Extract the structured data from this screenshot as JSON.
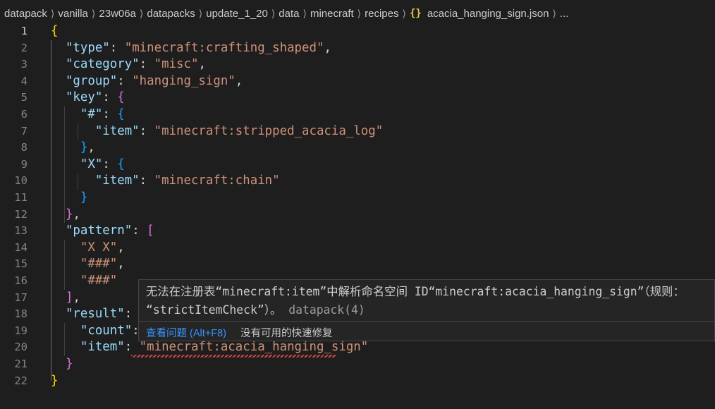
{
  "breadcrumb": {
    "items": [
      "datapack",
      "vanilla",
      "23w06a",
      "datapacks",
      "update_1_20",
      "data",
      "minecraft",
      "recipes"
    ],
    "json_icon": "{}",
    "file": "acacia_hanging_sign.json",
    "ellipsis": "..."
  },
  "editor": {
    "line_numbers": [
      "1",
      "2",
      "3",
      "4",
      "5",
      "6",
      "7",
      "8",
      "9",
      "10",
      "11",
      "12",
      "13",
      "14",
      "15",
      "16",
      "17",
      "18",
      "19",
      "20",
      "21",
      "22"
    ],
    "active_line": "1",
    "tokens": {
      "l1_open": "{",
      "k_type": "\"type\"",
      "v_type": "\"minecraft:crafting_shaped\"",
      "k_category": "\"category\"",
      "v_category": "\"misc\"",
      "k_group": "\"group\"",
      "v_group": "\"hanging_sign\"",
      "k_key": "\"key\"",
      "b_key_open": "{",
      "k_hash": "\"#\"",
      "b_hash_open": "{",
      "k_item1": "\"item\"",
      "v_item1": "\"minecraft:stripped_acacia_log\"",
      "b_hash_close": "}",
      "k_x": "\"X\"",
      "b_x_open": "{",
      "k_item2": "\"item\"",
      "v_item2": "\"minecraft:chain\"",
      "b_x_close": "}",
      "b_key_close": "}",
      "k_pattern": "\"pattern\"",
      "b_pattern_open": "[",
      "v_p1": "\"X X\"",
      "v_p2": "\"###\"",
      "v_p3": "\"###\"",
      "b_pattern_close": "]",
      "k_result": "\"result\"",
      "b_result_open": "{",
      "k_count": "\"count\"",
      "k_item3": "\"item\"",
      "v_item3": "\"minecraft:acacia_hanging_sign\"",
      "b_result_close": "}",
      "l22_close": "}",
      "colon": ": ",
      "comma": ","
    }
  },
  "hover": {
    "message_line1": "无法在注册表“minecraft:item”中解析命名空间 ID“minecraft:acacia_hanging_sign”（规则：",
    "message_line2": "“strictItemCheck”）。",
    "source": "datapack(4)",
    "view_problem_label": "查看问题 (Alt+F8)",
    "no_fix_label": "没有可用的快速修复"
  },
  "colors": {
    "background": "#1e1e1e",
    "key": "#9cdcfe",
    "string": "#ce9178",
    "bracket_level1": "#ffd700",
    "bracket_level2": "#da70d6",
    "bracket_level3": "#179fff",
    "error": "#f14c4c",
    "link": "#3794ff"
  }
}
